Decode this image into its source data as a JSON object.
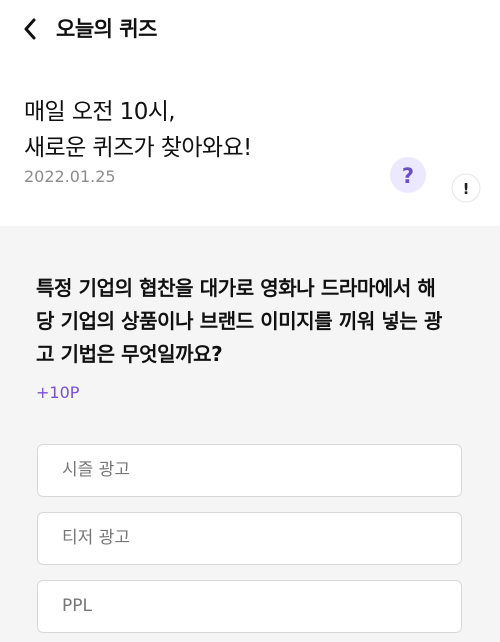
{
  "header": {
    "title": "오늘의 퀴즈",
    "back_icon": "chevron-left-icon"
  },
  "hero": {
    "headline_lines": [
      "매일 오전 10시,",
      "새로운 퀴즈가 찾아와요!"
    ],
    "date": "2022.01.25",
    "mascot": {
      "question_mark": "?",
      "exclamation_mark": "!",
      "colors": {
        "body": "#f0188c",
        "bubble": "#ece8ff",
        "question_mark": "#6a4fc2"
      }
    }
  },
  "quiz": {
    "question_lines": [
      "특정 기업의 협찬을 대가로 영화나 드라마에서 해",
      "당 기업의 상품이나 브랜드 이미지를 끼워 넣는 광",
      "고 기법은 무엇일까요?"
    ],
    "points": "+10P",
    "options": [
      {
        "label": "시즐 광고"
      },
      {
        "label": "티저 광고"
      },
      {
        "label": "PPL"
      }
    ]
  },
  "colors": {
    "accent": "#7a4fd6",
    "section_background": "#f5f5f5",
    "option_border": "#d8d8d8"
  }
}
